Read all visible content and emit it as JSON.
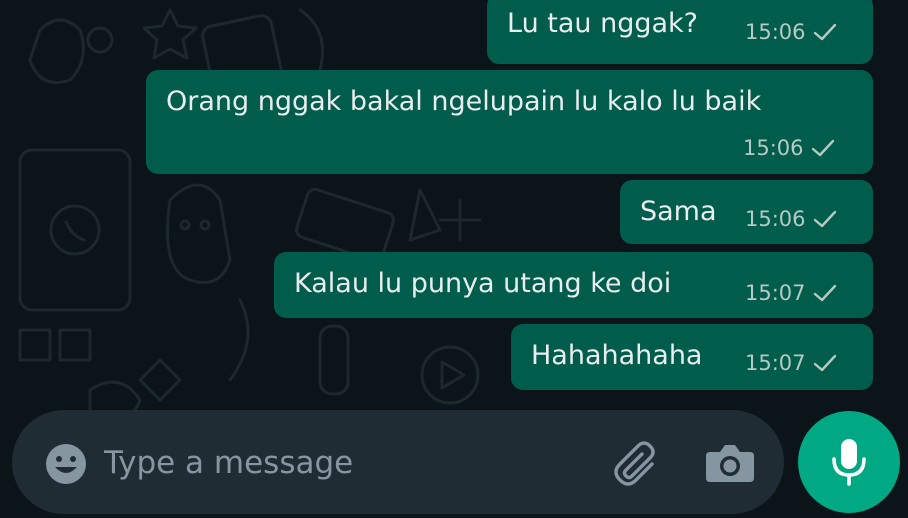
{
  "conversation": {
    "messages": [
      {
        "text": "Lu tau nggak?",
        "time": "15:06",
        "status": "sent"
      },
      {
        "text": "Orang nggak bakal ngelupain lu kalo lu baik",
        "time": "15:06",
        "status": "sent"
      },
      {
        "text": "Sama",
        "time": "15:06",
        "status": "sent"
      },
      {
        "text": "Kalau lu punya utang ke doi",
        "time": "15:07",
        "status": "sent"
      },
      {
        "text": "Hahahahaha",
        "time": "15:07",
        "status": "sent"
      }
    ]
  },
  "composer": {
    "placeholder": "Type a message",
    "value": ""
  },
  "icons": {
    "emoji": "emoji-icon",
    "attach": "paperclip-icon",
    "camera": "camera-icon",
    "mic": "microphone-icon",
    "tick": "single-check-icon"
  },
  "colors": {
    "background": "#0b1418",
    "outgoing_bubble": "#005c4b",
    "input_bar": "#1f2c34",
    "accent": "#00a884"
  }
}
